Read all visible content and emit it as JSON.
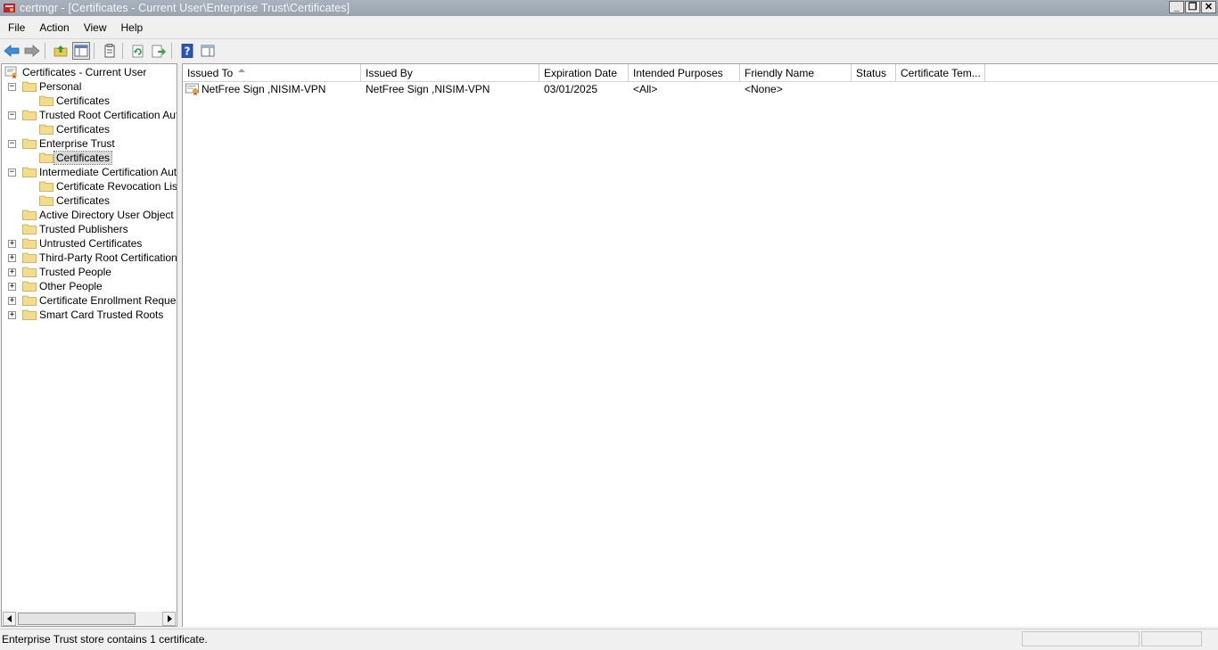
{
  "window": {
    "title": "certmgr - [Certificates - Current User\\Enterprise Trust\\Certificates]",
    "controls": {
      "minimize": "_",
      "restore": "❐",
      "close": "✕"
    }
  },
  "menu": [
    "File",
    "Action",
    "View",
    "Help"
  ],
  "toolbar": {
    "icons": [
      "back-arrow-icon",
      "forward-arrow-icon",
      "up-folder-icon",
      "show-hide-console-tree-icon",
      "properties-icon",
      "refresh-icon",
      "export-list-icon",
      "help-icon",
      "show-hide-action-pane-icon"
    ]
  },
  "tree": {
    "root": "Certificates - Current User",
    "items": [
      {
        "label": "Personal",
        "expander": "−",
        "children": [
          "Certificates"
        ]
      },
      {
        "label": "Trusted Root Certification Autho",
        "expander": "−",
        "children": [
          "Certificates"
        ]
      },
      {
        "label": "Enterprise Trust",
        "expander": "−",
        "children": [
          "Certificates"
        ]
      },
      {
        "label": "Intermediate Certification Autho",
        "expander": "−",
        "children": [
          "Certificate Revocation List",
          "Certificates"
        ]
      },
      {
        "label": "Active Directory User Object",
        "expander": "",
        "children": []
      },
      {
        "label": "Trusted Publishers",
        "expander": "",
        "children": []
      },
      {
        "label": "Untrusted Certificates",
        "expander": "+",
        "children": []
      },
      {
        "label": "Third-Party Root Certification Au",
        "expander": "+",
        "children": []
      },
      {
        "label": "Trusted People",
        "expander": "+",
        "children": []
      },
      {
        "label": "Other People",
        "expander": "+",
        "children": []
      },
      {
        "label": "Certificate Enrollment Requests",
        "expander": "+",
        "children": []
      },
      {
        "label": "Smart Card Trusted Roots",
        "expander": "+",
        "children": []
      }
    ],
    "selected": "Enterprise Trust\\Certificates"
  },
  "list": {
    "columns": [
      "Issued To",
      "Issued By",
      "Expiration Date",
      "Intended Purposes",
      "Friendly Name",
      "Status",
      "Certificate Tem..."
    ],
    "sort_column": "Issued To",
    "rows": [
      [
        "NetFree Sign ,NISIM-VPN",
        "NetFree Sign ,NISIM-VPN",
        "03/01/2025",
        "<All>",
        "<None>",
        "",
        ""
      ]
    ]
  },
  "status": {
    "text": "Enterprise Trust store contains 1 certificate."
  }
}
